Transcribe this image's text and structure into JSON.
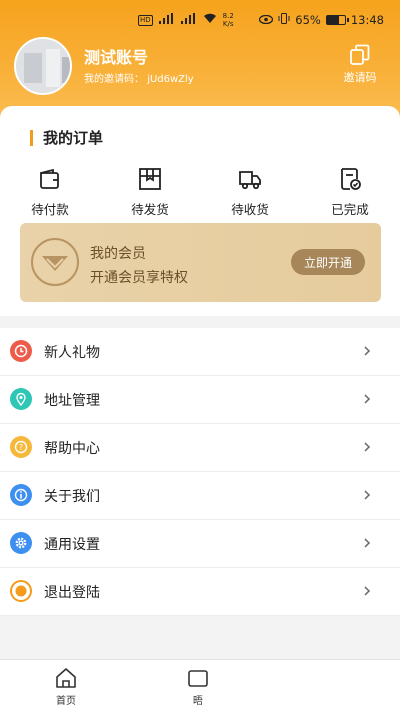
{
  "status_bar": {
    "network_tag": "HD",
    "speed_value": "8.2",
    "speed_unit": "K/s",
    "battery_percent": "65%",
    "battery_level": 0.65,
    "time": "13:48"
  },
  "profile": {
    "name": "测试账号",
    "invite_label": "我的邀请码：",
    "invite_code": "jUd6wZly",
    "invite_button": "邀请码"
  },
  "orders": {
    "title": "我的订单",
    "items": [
      {
        "label": "待付款",
        "icon": "wallet-icon"
      },
      {
        "label": "待发货",
        "icon": "box-icon"
      },
      {
        "label": "待收货",
        "icon": "truck-icon"
      },
      {
        "label": "已完成",
        "icon": "completed-doc-icon"
      }
    ]
  },
  "member": {
    "title": "我的会员",
    "subtitle": "开通会员享特权",
    "button": "立即开通"
  },
  "menu": {
    "items": [
      {
        "label": "新人礼物",
        "icon": "clock-icon",
        "color": "#ef5b4a"
      },
      {
        "label": "地址管理",
        "icon": "location-icon",
        "color": "#2ec7b5"
      },
      {
        "label": "帮助中心",
        "icon": "help-icon",
        "color": "#f5b83a"
      },
      {
        "label": "关于我们",
        "icon": "info-icon",
        "color": "#3d8ff0"
      },
      {
        "label": "通用设置",
        "icon": "gear-icon",
        "color": "#3d8ff0"
      },
      {
        "label": "退出登陆",
        "icon": "logout-icon",
        "color": "#f39b1a"
      }
    ]
  },
  "tabbar": {
    "home_label": "首页",
    "second_label": "晤"
  },
  "colors": {
    "header_orange": "#f6a31d",
    "accent": "#f39b1a",
    "member_gold": "#a7865a"
  }
}
